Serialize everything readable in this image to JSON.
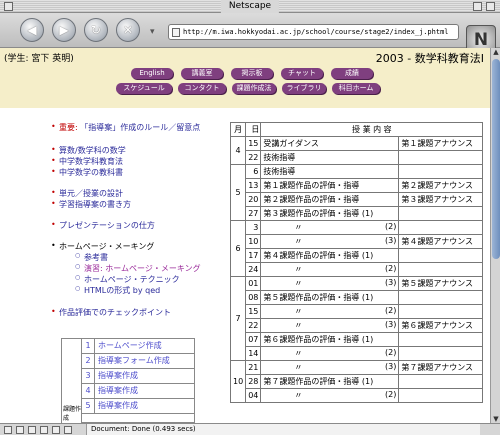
{
  "window": {
    "title": "Netscape"
  },
  "browser": {
    "url": "http://m.iwa.hokkyodai.ac.jp/school/course/stage2/index_j.phtml",
    "status": "Document: Done (0.493 secs)",
    "logo": "N"
  },
  "banner": {
    "student": "(学生: 宮下 英明)",
    "course": "2003 - 数学科教育法Ⅰ",
    "nav_row1": [
      "English",
      "講義室",
      "掲示板",
      "チャット",
      "成績"
    ],
    "nav_row2": [
      "スケジュール",
      "コンタクト",
      "課題作成法",
      "ライブラリ",
      "科目ホーム"
    ]
  },
  "left": {
    "important_prefix": "重要:",
    "important_link": "「指導案」作成のルール／留意点",
    "group1": [
      "算数/数学科の数学",
      "中学数学科教育法",
      "中学数学の教科書"
    ],
    "group2": [
      "単元／授業の設計",
      "学習指導案の書き方"
    ],
    "presentation": "プレゼンテーションの仕方",
    "hp_heading": "ホームページ・メーキング",
    "hp_items": [
      "参考書",
      "演習: ホームページ・メーキング",
      "ホームページ・テクニック",
      "HTMLの形式 by qed"
    ],
    "checkpoint": "作品評価でのチェックポイント"
  },
  "mini_nav": {
    "rail_label": "課題作成",
    "items": [
      {
        "num": "1",
        "label": "ホームページ作成"
      },
      {
        "num": "2",
        "label": "指導案フォーム作成"
      },
      {
        "num": "3",
        "label": "指導案作成"
      },
      {
        "num": "4",
        "label": "指導案作成"
      },
      {
        "num": "5",
        "label": "指導案作成"
      }
    ]
  },
  "schedule": {
    "headers": {
      "month": "月",
      "day": "日",
      "content": "授 業 内 容"
    },
    "rows": [
      {
        "m": "4",
        "d": "15",
        "c": "受講ガイダンス",
        "r": "第１課題アナウンス"
      },
      {
        "m": "",
        "d": "22",
        "c": "技術指導",
        "r": ""
      },
      {
        "m": "",
        "d": "6",
        "c": "技術指導",
        "r": ""
      },
      {
        "m": "5",
        "d": "13",
        "c": "第１課題作品の評価・指導",
        "r": "第２課題アナウンス"
      },
      {
        "m": "",
        "d": "20",
        "c": "第２課題作品の評価・指導",
        "r": "第３課題アナウンス"
      },
      {
        "m": "",
        "d": "27",
        "c": "第３課題作品の評価・指導 (1)",
        "r": ""
      },
      {
        "m": "",
        "d": "3",
        "c": "〃",
        "cr": "(2)",
        "r": ""
      },
      {
        "m": "",
        "d": "10",
        "c": "〃",
        "cr": "(3)",
        "r": "第４課題アナウンス"
      },
      {
        "m": "6",
        "d": "17",
        "c": "第４課題作品の評価・指導 (1)",
        "r": ""
      },
      {
        "m": "",
        "d": "24",
        "c": "〃",
        "cr": "(2)",
        "r": ""
      },
      {
        "m": "",
        "d": "01",
        "c": "〃",
        "cr": "(3)",
        "r": "第５課題アナウンス"
      },
      {
        "m": "",
        "d": "08",
        "c": "第５課題作品の評価・指導 (1)",
        "r": ""
      },
      {
        "m": "7",
        "d": "15",
        "c": "〃",
        "cr": "(2)",
        "r": ""
      },
      {
        "m": "",
        "d": "22",
        "c": "〃",
        "cr": "(3)",
        "r": "第６課題アナウンス"
      },
      {
        "m": "",
        "d": "07",
        "c": "第６課題作品の評価・指導 (1)",
        "r": ""
      },
      {
        "m": "",
        "d": "14",
        "c": "〃",
        "cr": "(2)",
        "r": ""
      },
      {
        "m": "10",
        "d": "21",
        "c": "〃",
        "cr": "(3)",
        "r": "第７課題アナウンス"
      },
      {
        "m": "",
        "d": "28",
        "c": "第７課題作品の評価・指導 (1)",
        "r": ""
      },
      {
        "m": "",
        "d": "04",
        "c": "〃",
        "cr": "(2)",
        "r": ""
      }
    ]
  },
  "colors": {
    "banner_bg": "#f5eec9",
    "pill": "#7f3f7f",
    "link_blue": "#2a2a9a",
    "link_purple": "#9a2a9a",
    "bullet_red": "#c00000"
  }
}
